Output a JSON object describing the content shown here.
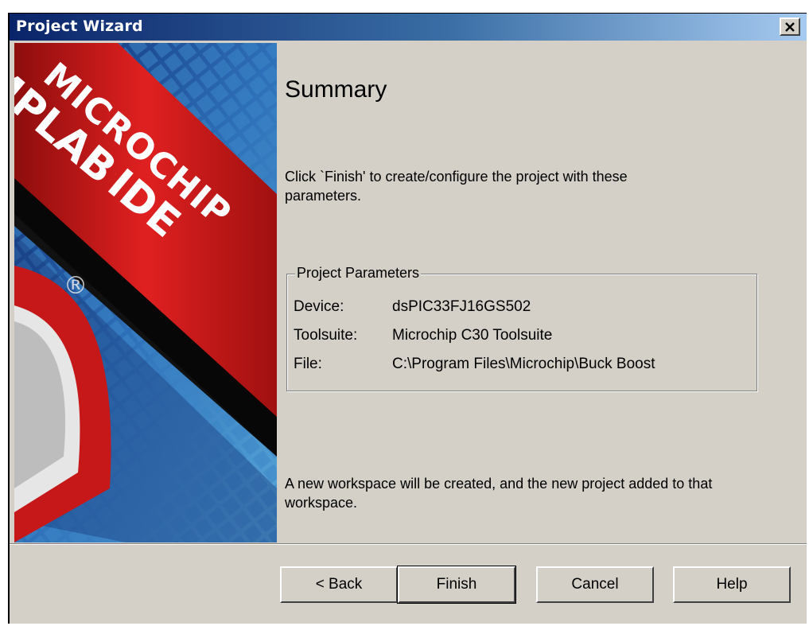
{
  "window": {
    "title": "Project Wizard",
    "close_icon": "close-icon"
  },
  "banner": {
    "brand_line1": "MICROCHIP",
    "brand_line2": "MPLAB",
    "brand_line3": "IDE",
    "registered": "®"
  },
  "page": {
    "heading": "Summary",
    "instructions": "Click `Finish' to create/configure the project with these parameters.",
    "params_group_label": "Project Parameters",
    "params": [
      {
        "key": "Device:",
        "value": "dsPIC33FJ16GS502"
      },
      {
        "key": "Toolsuite:",
        "value": "Microchip C30 Toolsuite"
      },
      {
        "key": "File:",
        "value": "C:\\Program Files\\Microchip\\Buck Boost"
      }
    ],
    "footer_note": "A new workspace will be created, and the new project added to that workspace."
  },
  "buttons": {
    "back": "< Back",
    "finish": "Finish",
    "cancel": "Cancel",
    "help": "Help"
  },
  "colors": {
    "titlebar_start": "#0a246a",
    "titlebar_end": "#a6caf0",
    "dialog_bg": "#d4d0c8",
    "banner_red": "#d11a1a"
  }
}
